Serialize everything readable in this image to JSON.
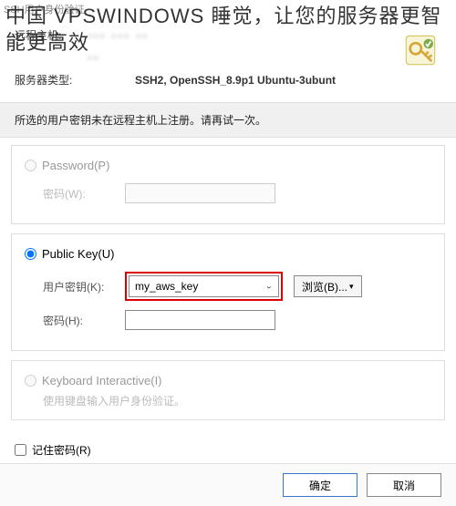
{
  "window": {
    "title": "SSH用户身份验证"
  },
  "headline": "中国 VPSWINDOWS 睡觉，让您的服务器更智能更高效",
  "header": {
    "remote_host_label": "远程主机:",
    "login_label": "",
    "server_type_label": "服务器类型:",
    "server_type_value": "SSH2, OpenSSH_8.9p1 Ubuntu-3ubunt"
  },
  "message": "所选的用户密钥未在远程主机上注册。请再试一次。",
  "auth": {
    "password": {
      "radio_label": "Password(P)",
      "field_label": "密码(W):"
    },
    "publickey": {
      "radio_label": "Public Key(U)",
      "key_label": "用户密钥(K):",
      "key_value": "my_aws_key",
      "browse_label": "浏览(B)...",
      "passphrase_label": "密码(H):"
    },
    "keyboard": {
      "radio_label": "Keyboard Interactive(I)",
      "hint": "使用键盘输入用户身份验证。"
    }
  },
  "remember_label": "记住密码(R)",
  "buttons": {
    "ok": "确定",
    "cancel": "取消"
  },
  "icons": {
    "key": "key-icon",
    "chevron_down": "chevron-down-icon"
  }
}
